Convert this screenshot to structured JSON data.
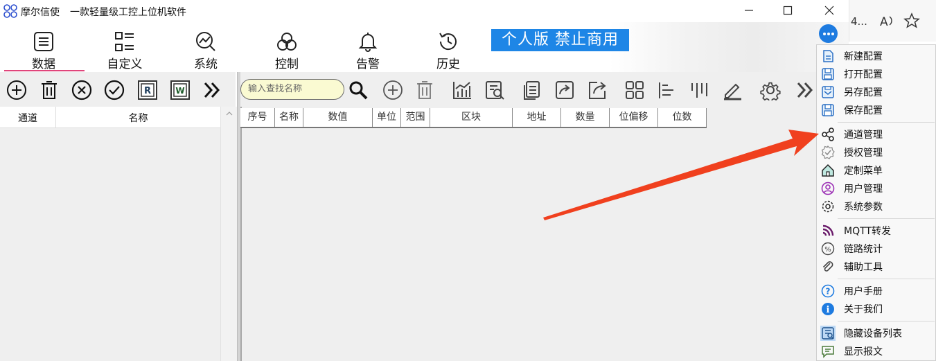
{
  "app": {
    "title": "摩尔信使",
    "subtitle": "一款轻量级工控上位机软件"
  },
  "ribbon": {
    "tabs": [
      {
        "label": "数据",
        "icon": "list-doc-icon",
        "active": true
      },
      {
        "label": "自定义",
        "icon": "custom-layout-icon"
      },
      {
        "label": "系统",
        "icon": "chart-gear-icon"
      },
      {
        "label": "控制",
        "icon": "control-knot-icon"
      },
      {
        "label": "告警",
        "icon": "bell-icon"
      },
      {
        "label": "历史",
        "icon": "history-clock-icon"
      }
    ],
    "banner": "个人版  禁止商用",
    "accent": "#1e86e6"
  },
  "search": {
    "placeholder": "输入查找名称"
  },
  "left_table": {
    "columns": [
      "通道",
      "名称"
    ]
  },
  "grid": {
    "columns": [
      "序号",
      "名称",
      "数值",
      "单位",
      "范围",
      "区块",
      "地址",
      "数量",
      "位偏移",
      "位数"
    ]
  },
  "browser": {
    "text": "4..."
  },
  "menu": {
    "groups": [
      [
        {
          "label": "新建配置",
          "icon": "new-file-icon"
        },
        {
          "label": "打开配置",
          "icon": "open-file-icon"
        },
        {
          "label": "另存配置",
          "icon": "save-as-icon"
        },
        {
          "label": "保存配置",
          "icon": "save-icon"
        }
      ],
      [
        {
          "label": "通道管理",
          "icon": "share-nodes-icon"
        },
        {
          "label": "授权管理",
          "icon": "badge-check-icon"
        },
        {
          "label": "定制菜单",
          "icon": "home-icon"
        },
        {
          "label": "用户管理",
          "icon": "user-circle-icon"
        },
        {
          "label": "系统参数",
          "icon": "gear-icon"
        }
      ],
      [
        {
          "label": "MQTT转发",
          "icon": "rss-icon"
        },
        {
          "label": "链路统计",
          "icon": "percent-icon"
        },
        {
          "label": "辅助工具",
          "icon": "paperclip-icon"
        }
      ],
      [
        {
          "label": "用户手册",
          "icon": "help-icon"
        },
        {
          "label": "关于我们",
          "icon": "info-icon"
        }
      ],
      [
        {
          "label": "隐藏设备列表",
          "icon": "device-list-icon"
        },
        {
          "label": "显示报文",
          "icon": "message-icon"
        }
      ]
    ]
  }
}
